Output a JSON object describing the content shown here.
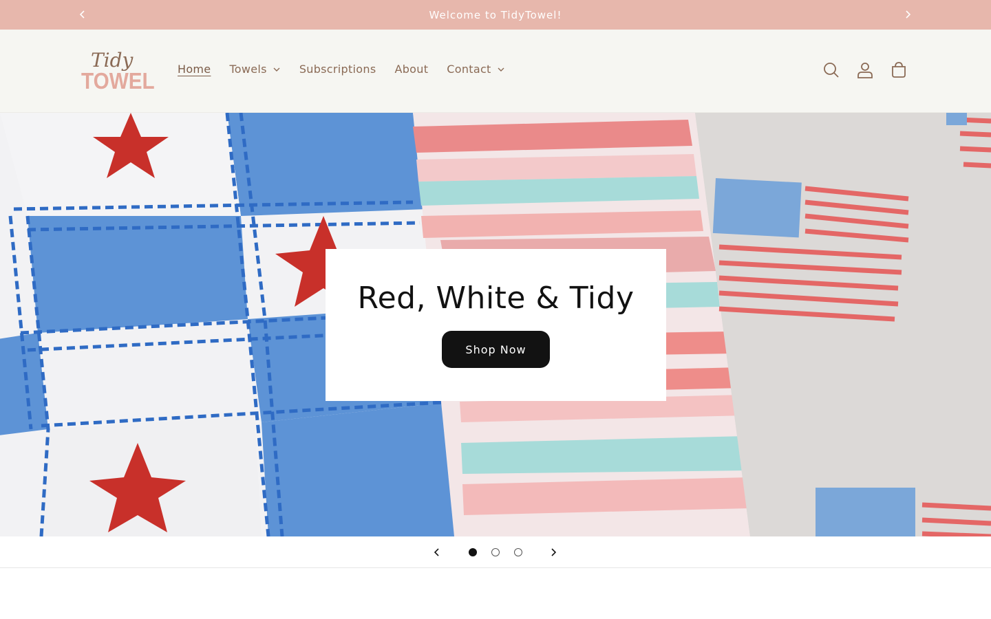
{
  "announcement": {
    "text": "Welcome to TidyTowel!",
    "prev_icon": "chevron-left-icon",
    "next_icon": "chevron-right-icon"
  },
  "header": {
    "logo": {
      "line1": "Tidy",
      "line2": "TOWEL"
    },
    "nav": [
      {
        "label": "Home",
        "active": true,
        "has_dropdown": false
      },
      {
        "label": "Towels",
        "active": false,
        "has_dropdown": true
      },
      {
        "label": "Subscriptions",
        "active": false,
        "has_dropdown": false
      },
      {
        "label": "About",
        "active": false,
        "has_dropdown": false
      },
      {
        "label": "Contact",
        "active": false,
        "has_dropdown": true
      }
    ],
    "icons": [
      "search-icon",
      "account-icon",
      "cart-icon"
    ]
  },
  "hero": {
    "title": "Red, White & Tidy",
    "button_label": "Shop Now"
  },
  "slider": {
    "slide_count": 3,
    "current_slide": 1,
    "prev_icon": "chevron-left-icon",
    "next_icon": "chevron-right-icon"
  },
  "colors": {
    "announcement_bg": "#e7b7ac",
    "header_bg": "#f6f6f2",
    "text_brown": "#8a6a55",
    "button_bg": "#121212"
  }
}
